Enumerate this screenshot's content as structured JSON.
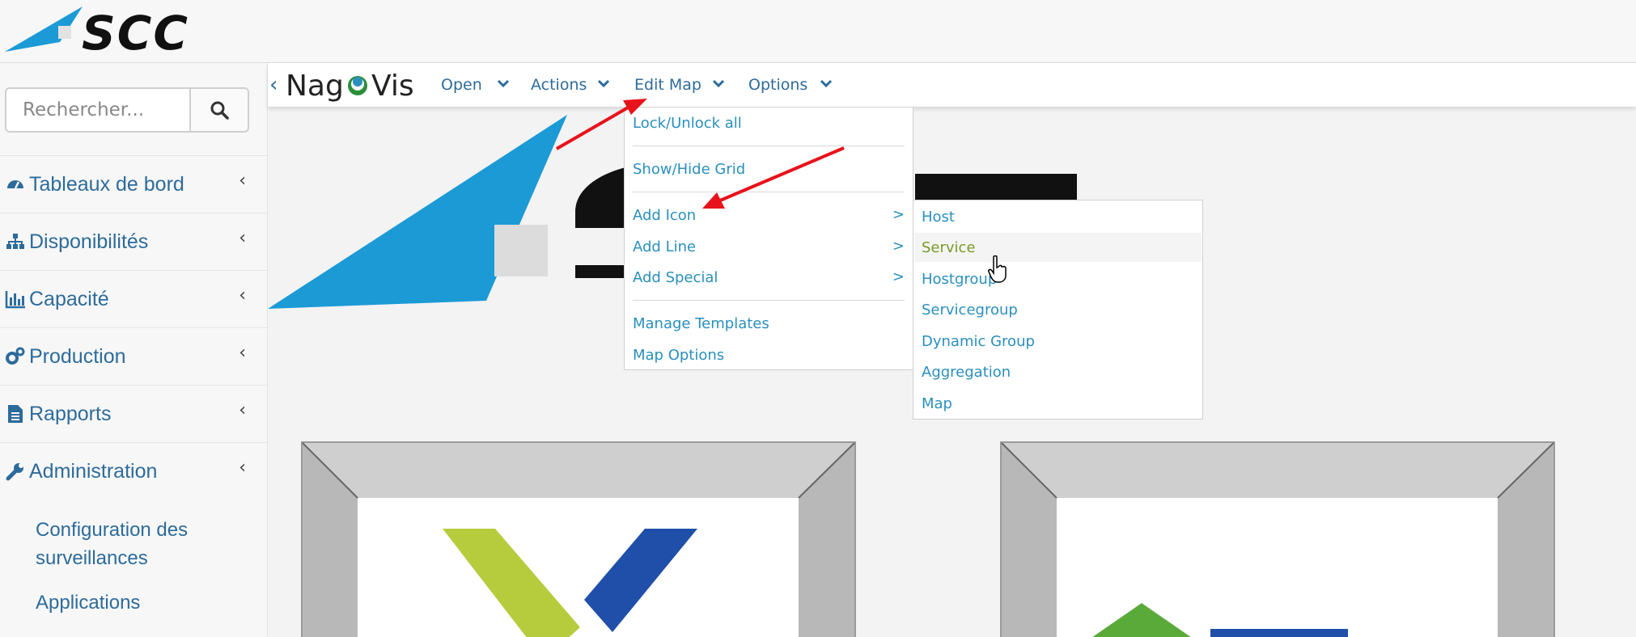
{
  "brand": {
    "name": "SCC"
  },
  "sidebar": {
    "search": {
      "placeholder": "Rechercher..."
    },
    "items": [
      {
        "label": "Tableaux de bord",
        "icon": "dashboard-icon"
      },
      {
        "label": "Disponibilités",
        "icon": "sitemap-icon"
      },
      {
        "label": "Capacité",
        "icon": "bar-chart-icon"
      },
      {
        "label": "Production",
        "icon": "gears-icon"
      },
      {
        "label": "Rapports",
        "icon": "file-text-icon"
      },
      {
        "label": "Administration",
        "icon": "wrench-icon"
      }
    ],
    "subitems": [
      {
        "label_line1": "Configuration des",
        "label_line2": "surveillances"
      },
      {
        "label_line1": "Applications"
      }
    ]
  },
  "nagvis": {
    "logo": "NagVis",
    "menu": [
      "Open",
      "Actions",
      "Edit Map",
      "Options"
    ]
  },
  "edit_map_menu": {
    "items": [
      {
        "label": "Lock/Unlock all"
      },
      {
        "label": "Show/Hide Grid"
      },
      {
        "label": "Add Icon",
        "submenu": ">"
      },
      {
        "label": "Add Line",
        "submenu": ">"
      },
      {
        "label": "Add Special",
        "submenu": ">"
      },
      {
        "label": "Manage Templates"
      },
      {
        "label": "Map Options"
      }
    ]
  },
  "add_icon_submenu": {
    "items": [
      "Host",
      "Service",
      "Hostgroup",
      "Servicegroup",
      "Dynamic Group",
      "Aggregation",
      "Map"
    ],
    "hovered": "Service",
    "hover_color": "#7a9a2a"
  },
  "colors": {
    "link": "#2a8fbd",
    "sidebar_link": "#2d6b9b",
    "arrow": "#e8121b",
    "brand_blue": "#1b9ad6"
  }
}
